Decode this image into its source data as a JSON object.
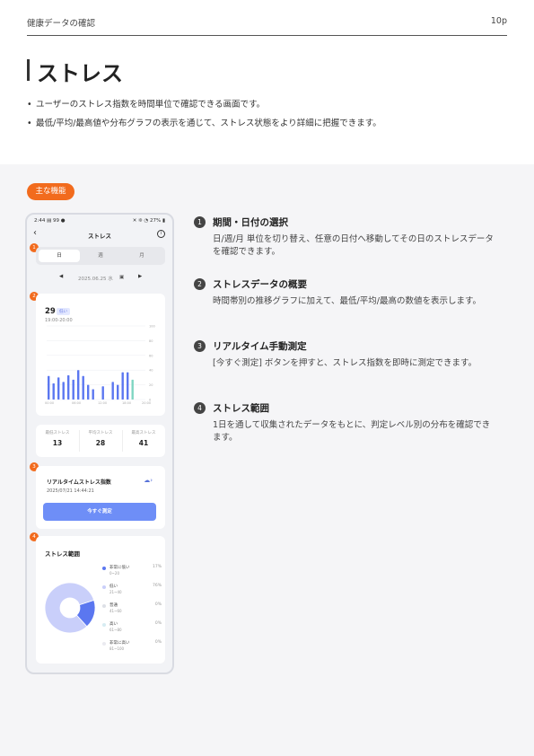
{
  "header": {
    "doc_title": "健康データの確認",
    "page_num": "10p"
  },
  "title": "ストレス",
  "bullets": [
    "ユーザーのストレス指数を時間単位で確認できる画面です。",
    "最低/平均/最高値や分布グラフの表示を通じて、ストレス状態をより詳細に把握できます。"
  ],
  "badge": "主な機能",
  "phone": {
    "status_time": "2:44 ▤ 99 ●",
    "status_right": "✕ ❊ ◔ 27% ▮",
    "back_icon": "‹",
    "app_title": "ストレス",
    "info_icon": "i",
    "markers": [
      "1",
      "2",
      "3",
      "4"
    ],
    "tabs": [
      "日",
      "週",
      "月"
    ],
    "date_prev": "◀",
    "date": "2025.06.25 水",
    "calendar_icon": "▣",
    "date_next": "▶",
    "current_value": "29",
    "current_level": "低い",
    "time_range": "19:00-20:00",
    "stats": [
      {
        "label": "最低ストレス",
        "value": "13"
      },
      {
        "label": "平均ストレス",
        "value": "28"
      },
      {
        "label": "最高ストレス",
        "value": "41"
      }
    ],
    "realtime": {
      "title": "リアルタイムストレス指数",
      "timestamp": "2025/07/21 14:44:21",
      "icon": "☁›",
      "button": "今すぐ測定"
    },
    "range": {
      "title": "ストレス範囲",
      "levels": [
        {
          "name": "非常に低い",
          "range": "0~20",
          "percent": "17%",
          "color": "#5b77f0"
        },
        {
          "name": "低い",
          "range": "21~40",
          "percent": "76%",
          "color": "#c9cffa"
        },
        {
          "name": "普通",
          "range": "41~60",
          "percent": "0%",
          "color": "#dde0e6"
        },
        {
          "name": "高い",
          "range": "61~80",
          "percent": "0%",
          "color": "#d6ecf2"
        },
        {
          "name": "非常に高い",
          "range": "81~100",
          "percent": "0%",
          "color": "#eaeaf0"
        }
      ]
    }
  },
  "chart_data": {
    "type": "bar",
    "x_ticks": [
      "00:00",
      "06:00",
      "12:00",
      "18:00",
      "20:00"
    ],
    "y_ticks": [
      0,
      20,
      40,
      60,
      80,
      100
    ],
    "ylim": [
      0,
      100
    ],
    "values": [
      32,
      22,
      30,
      24,
      33,
      27,
      40,
      32,
      20,
      14,
      18,
      24,
      20,
      37,
      37,
      27
    ],
    "highlight_index": 15,
    "colors": {
      "bar": "#5b77f0",
      "highlight": "#7fd6c2"
    }
  },
  "features": [
    {
      "num": "1",
      "title": "期間・日付の選択",
      "desc": "日/週/月 単位を切り替え、任意の日付へ移動してその日のストレスデータを確認できます。"
    },
    {
      "num": "2",
      "title": "ストレスデータの概要",
      "desc": "時間帯別の推移グラフに加えて、最低/平均/最高の数値を表示します。"
    },
    {
      "num": "3",
      "title": "リアルタイム手動測定",
      "desc": "[今すぐ測定] ボタンを押すと、ストレス指数を即時に測定できます。"
    },
    {
      "num": "4",
      "title": "ストレス範囲",
      "desc": "1日を通して収集されたデータをもとに、判定レベル別の分布を確認できます。"
    }
  ]
}
